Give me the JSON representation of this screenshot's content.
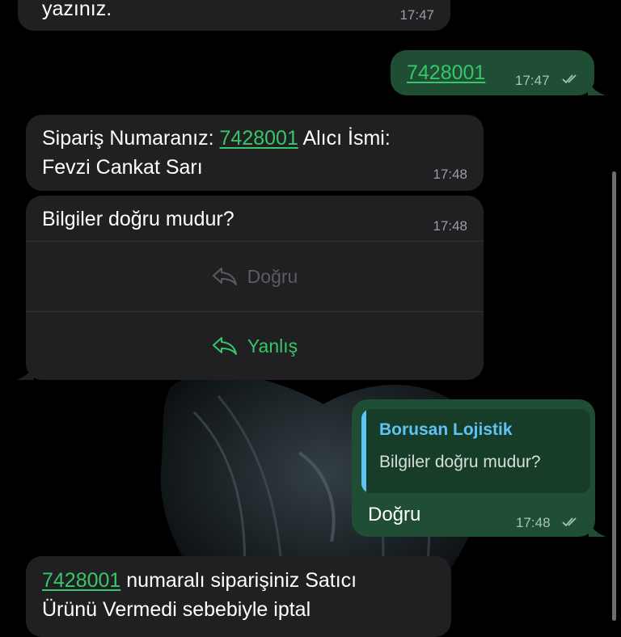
{
  "messages": {
    "m1": {
      "text": "yazınız.",
      "time": "17:47"
    },
    "m2": {
      "number": "7428001",
      "time": "17:47"
    },
    "m3": {
      "prefix": "Sipariş Numaranız:",
      "number": "7428001",
      "suffix": "Alıcı İsmi:",
      "line2": "Fevzi Cankat Sarı",
      "time": "17:48"
    },
    "m4": {
      "text": "Bilgiler doğru mudur?",
      "time": "17:48",
      "buttons": [
        {
          "label": "Doğru",
          "icon": "reply-icon",
          "state": "disabled"
        },
        {
          "label": "Yanlış",
          "icon": "reply-icon",
          "state": "active"
        }
      ]
    },
    "m5": {
      "quote_author": "Borusan Lojistik",
      "quote_text": "Bilgiler doğru mudur?",
      "text": "Doğru",
      "time": "17:48"
    },
    "m6": {
      "number": "7428001",
      "line1_suffix": "numaralı siparişiniz Satıcı",
      "line2": "Ürünü Vermedi sebebiyle iptal"
    }
  },
  "colors": {
    "incoming_bubble": "#202022",
    "outgoing_bubble": "#1f4e34",
    "link": "#35c76a",
    "quote_accent": "#5fc3f5",
    "background": "#000000"
  },
  "icons": {
    "read_receipt": "double-check-icon",
    "reply": "reply-icon"
  }
}
